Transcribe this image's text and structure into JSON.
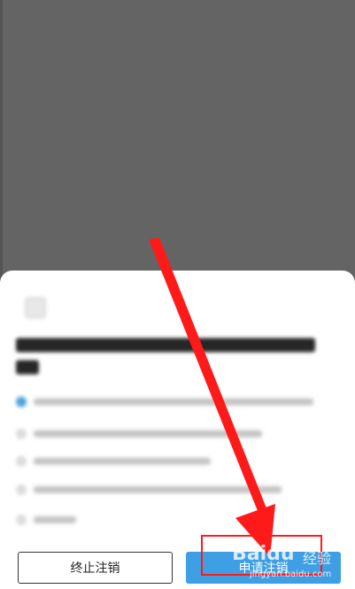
{
  "footer": {
    "terminate_label": "终止注销",
    "apply_label": "申请注销"
  },
  "watermark": {
    "brand": "Bai",
    "brand_suffix": "du",
    "product": "经验",
    "url": "jingyan.baidu.com"
  },
  "colors": {
    "overlay": "#646464",
    "sheet": "#ffffff",
    "apply_button": "#3f9fe4",
    "annotation": "#ff1a1a"
  },
  "icons": {
    "close": "close-icon",
    "selected_option": "radio-selected-icon"
  }
}
